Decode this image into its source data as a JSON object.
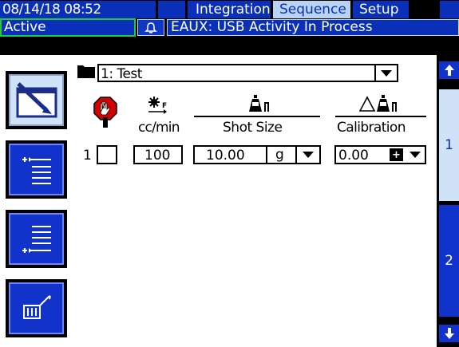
{
  "header": {
    "datetime": "08/14/18 08:52",
    "tabs": [
      {
        "label": "Integration",
        "active": false
      },
      {
        "label": "Sequence",
        "active": true
      },
      {
        "label": "Setup",
        "active": false
      }
    ]
  },
  "status": {
    "state": "Active",
    "message": "EAUX: USB Activity In Process"
  },
  "sequence": {
    "selected": "1: Test"
  },
  "table": {
    "rate_unit": "cc/min",
    "shot_size_label": "Shot Size",
    "calibration_label": "Calibration",
    "rows": [
      {
        "index": "1",
        "flow_rate": "100",
        "shot_size": "10.00",
        "shot_unit": "g",
        "calibration": "0.00",
        "cal_sign": "+"
      }
    ]
  },
  "pages": [
    "1",
    "2"
  ],
  "colors": {
    "accent": "#0a2fb8",
    "highlight": "#b9d3f2",
    "stop": "#d40000"
  }
}
